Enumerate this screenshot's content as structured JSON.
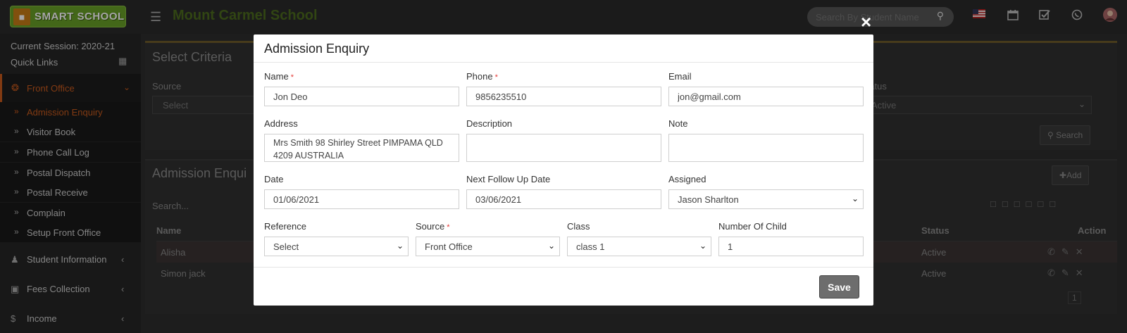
{
  "header": {
    "logo_text": "SMART SCHOOL",
    "school_name": "Mount Carmel School",
    "search_placeholder": "Search By Student Name"
  },
  "sidebar": {
    "session": "Current Session: 2020-21",
    "quick_links": "Quick Links",
    "front_office": "Front Office",
    "sub_items": [
      "Admission Enquiry",
      "Visitor Book",
      "Phone Call Log",
      "Postal Dispatch",
      "Postal Receive",
      "Complain",
      "Setup Front Office"
    ],
    "items": [
      "Student Information",
      "Fees Collection",
      "Income"
    ]
  },
  "background": {
    "criteria_title": "Select Criteria",
    "source_label": "Source",
    "source_value": "Select",
    "status_label": "Status",
    "status_value": "Active",
    "search_btn": "Search",
    "list_title": "Admission Enqui",
    "add_btn": "Add",
    "search_placeholder": "Search...",
    "col_name": "Name",
    "col_status": "Status",
    "col_action": "Action",
    "rows": [
      {
        "name": "Alisha",
        "status": "Active"
      },
      {
        "name": "Simon jack",
        "status": "Active"
      }
    ],
    "page": "1"
  },
  "modal": {
    "title": "Admission Enquiry",
    "close": "×",
    "name_label": "Name",
    "name_value": "Jon Deo",
    "phone_label": "Phone",
    "phone_value": "9856235510",
    "email_label": "Email",
    "email_value": "jon@gmail.com",
    "address_label": "Address",
    "address_value": "Mrs Smith 98 Shirley Street PIMPAMA QLD 4209 AUSTRALIA",
    "description_label": "Description",
    "description_value": "",
    "note_label": "Note",
    "note_value": "",
    "date_label": "Date",
    "date_value": "01/06/2021",
    "followup_label": "Next Follow Up Date",
    "followup_value": "03/06/2021",
    "assigned_label": "Assigned",
    "assigned_value": "Jason Sharlton",
    "reference_label": "Reference",
    "reference_value": "Select",
    "source_label": "Source",
    "source_value": "Front Office",
    "class_label": "Class",
    "class_value": "class 1",
    "children_label": "Number Of Child",
    "children_value": "1",
    "required_mark": "*",
    "save_btn": "Save"
  },
  "colors": {
    "accent": "#c7591c",
    "school_name": "#4c6b1e",
    "logo_bg": "#689f27"
  }
}
